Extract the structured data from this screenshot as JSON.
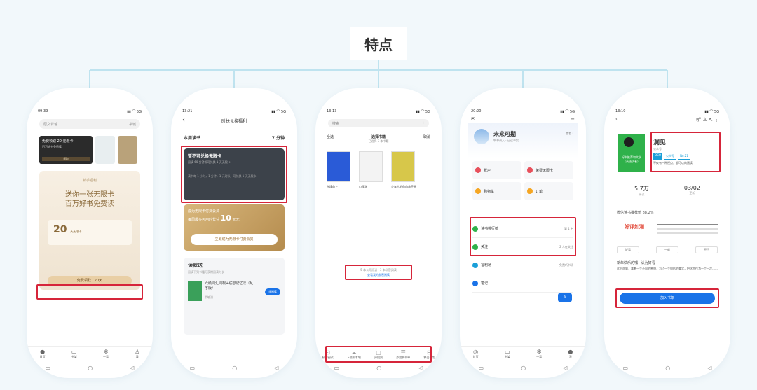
{
  "header": {
    "title": "特点"
  },
  "colors": {
    "highlight": "#d6253a",
    "accent": "#1a73e8",
    "tree_line": "#bfe3ef"
  },
  "phone1": {
    "time": "09:39",
    "status_icons": "▮▮ ⌒ 5G",
    "search": {
      "placeholder": "原文背着",
      "right_label": "书城"
    },
    "banner": {
      "title": "免费领取 20 无限卡",
      "subtitle": "百万好书免费读",
      "button": "领取"
    },
    "modal": {
      "eyebrow": "新手福利",
      "headline_1": "送你一张无限卡",
      "headline_2": "百万好书免费读",
      "card_value": "20",
      "card_unit": "天无限卡",
      "claim_button": "免费领取 · 20天"
    },
    "tabs": [
      {
        "icon": "home-icon",
        "glyph": "●",
        "label": "首页"
      },
      {
        "icon": "bookshelf-icon",
        "glyph": "▭",
        "label": "书架"
      },
      {
        "icon": "discover-icon",
        "glyph": "✻",
        "label": "一看"
      },
      {
        "icon": "me-icon",
        "glyph": "♙",
        "label": "我"
      }
    ]
  },
  "phone2": {
    "time": "13:21",
    "status_icons": "▮▮ ⌒ 5G",
    "page_title": "时长兑换福利",
    "weekly_label": "本周读书",
    "weekly_value": "7 分钟",
    "dark_card": {
      "title": "暂不可兑换无限卡",
      "subtitle": "阅读 60 分钟即可兑换 1 天无限卡",
      "desc": "读书每 1 小时，1 分钟，1 元时长 · 可兑换 1 天无限卡"
    },
    "gold_card": {
      "line1": "成为无限卡付费会员",
      "line2_pre": "每周最多可用时长兑",
      "line2_value": "10",
      "line2_post": "天无",
      "button": "立即成为无限卡付费会员"
    },
    "read": {
      "heading": "读就送",
      "sub": "阅读下列书籍可获赠阅读时长",
      "book_title": "六级词汇词根+联想记忆法（乱序版）",
      "book_author": "俞敏洪",
      "button": "领阅读"
    }
  },
  "phone3": {
    "time": "13:13",
    "status_icons": "▮▮ ⌒ 5G",
    "search": {
      "placeholder": "搜索",
      "plus": "+"
    },
    "top_tabs": [
      "全选",
      "选择书籍",
      "取消"
    ],
    "top_sub": "已选择 3 本书籍",
    "books": [
      {
        "label": "逆境向上"
      },
      {
        "label": "心理学"
      },
      {
        "label": "少年人的你自救手册"
      }
    ],
    "notice_1": "5 本公开阅读 · 3 本私密阅读",
    "notice_link": "查看我的私密阅读",
    "bottom": [
      {
        "icon": "private-read-icon",
        "glyph": "⊡",
        "label": "私密阅读"
      },
      {
        "icon": "download-icon",
        "glyph": "☁",
        "label": "下载到本地"
      },
      {
        "icon": "group-icon",
        "glyph": "▢",
        "label": "分组到"
      },
      {
        "icon": "list-icon",
        "glyph": "☰",
        "label": "添加到书单"
      },
      {
        "icon": "remove-icon",
        "glyph": "⊟",
        "label": "移出书架"
      }
    ]
  },
  "phone4": {
    "time": "20:20",
    "status_icons": "▮▮ ⌒ 5G",
    "top_left": "✉",
    "top_right": "≡",
    "name": "未来可期",
    "sub": "听书录入 · 已读书架",
    "sub_right": "查看 ›",
    "grid": [
      {
        "label": "账户",
        "color": "#e8505b"
      },
      {
        "label": "免费无限卡",
        "color": "#e8505b"
      },
      {
        "label": "购物车",
        "color": "#f5a623"
      },
      {
        "label": "订单",
        "color": "#f5a623"
      }
    ],
    "list": [
      {
        "label": "读书排行榜",
        "right": "第 1 名",
        "color": "#2fb14a"
      },
      {
        "label": "关注",
        "right": "2 人在关注",
        "color": "#2fb14a"
      },
      {
        "label": "福利场",
        "right": "免费听书场",
        "color": "#1a9fd8"
      },
      {
        "label": "笔记",
        "right": "",
        "color": "#1a73e8"
      }
    ],
    "tabs": [
      {
        "icon": "home-icon",
        "glyph": "◎",
        "label": "首页"
      },
      {
        "icon": "bookshelf-icon",
        "glyph": "▭",
        "label": "书架"
      },
      {
        "icon": "discover-icon",
        "glyph": "✻",
        "label": "一看"
      },
      {
        "icon": "me-icon",
        "glyph": "●",
        "label": "我"
      }
    ]
  },
  "phone5": {
    "time": "13:10",
    "status_icons": "▮▮ ⌒ 5G",
    "top_icons": "听  ♙  ⇱  ⋮",
    "cover_text": "好书推荐和文学（高级读者）",
    "title": "洞见",
    "publisher": "公众号",
    "badges": [
      "DCO",
      "公众号",
      "No.21"
    ],
    "note": "不仅有一种视点，都可以的阅读",
    "stats": [
      {
        "value": "5.7万",
        "label": "阅读"
      },
      {
        "value": "03/02",
        "label": "更新"
      }
    ],
    "recommend": "微信读书推荐值 88.2%",
    "good_label": "好评如潮",
    "votes": [
      "好看",
      "一般",
      "不行"
    ],
    "comment_user": "新年快乐的嘿 · 认为好看",
    "comment_text": "此时此刻，拿着一个不同的感想，为了一个电影的美学，把这些作为一个一次……",
    "join_button": "加入书架"
  }
}
